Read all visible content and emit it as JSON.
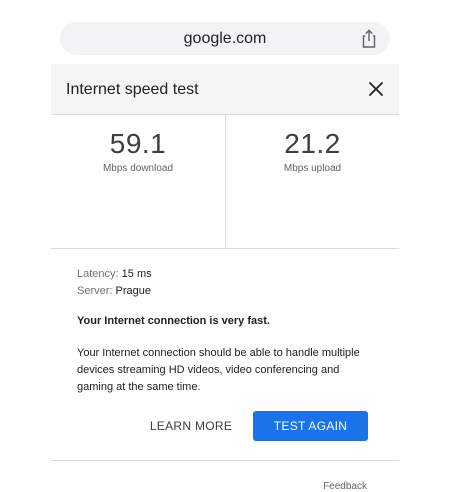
{
  "browser": {
    "url": "google.com",
    "share_icon": "share-icon"
  },
  "widget": {
    "title": "Internet speed test",
    "close_icon": "close-icon",
    "download": {
      "value": "59.1",
      "label": "Mbps download"
    },
    "upload": {
      "value": "21.2",
      "label": "Mbps upload"
    },
    "latency": {
      "label": "Latency:",
      "value": "15 ms"
    },
    "server": {
      "label": "Server:",
      "value": "Prague"
    },
    "verdict": "Your Internet connection is very fast.",
    "description": "Your Internet connection should be able to handle multiple devices streaming HD videos, video conferencing and gaming at the same time.",
    "learn_more_label": "LEARN MORE",
    "test_again_label": "TEST AGAIN",
    "feedback_label": "Feedback"
  },
  "colors": {
    "accent": "#1a73e8",
    "header_bg": "#f5f5f5",
    "url_bar_bg": "#f1f3f4",
    "divider": "#dadce0"
  }
}
